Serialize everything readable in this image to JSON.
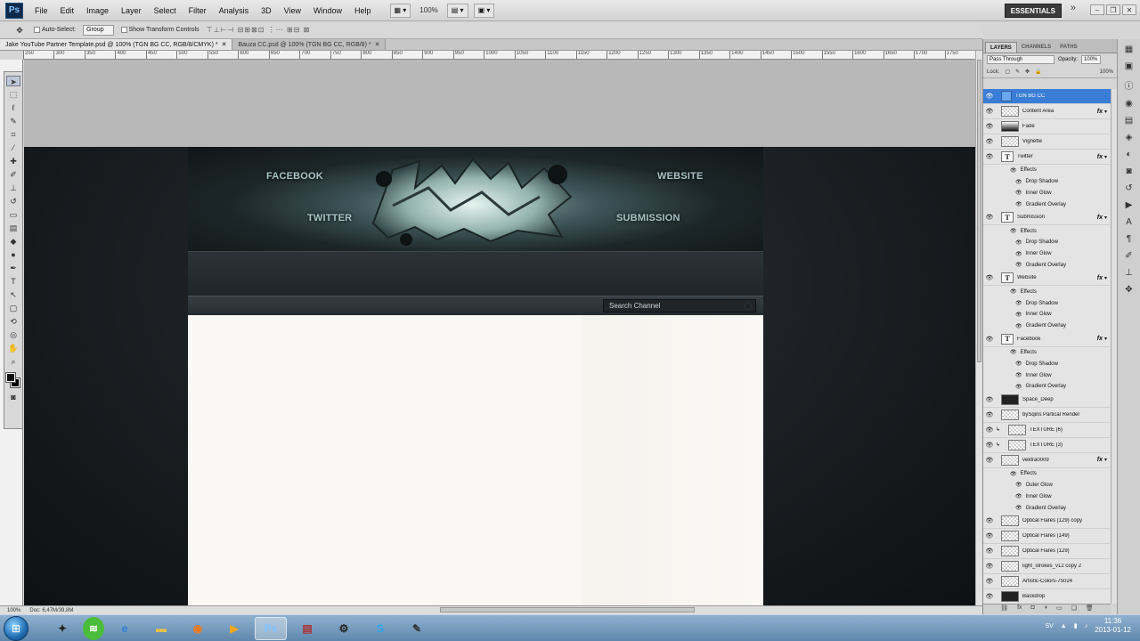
{
  "app": {
    "logo": "Ps",
    "menu": [
      "File",
      "Edit",
      "Image",
      "Layer",
      "Select",
      "Filter",
      "Analysis",
      "3D",
      "View",
      "Window",
      "Help"
    ],
    "zoom": "100%",
    "workspace": "ESSENTIALS"
  },
  "options_bar": {
    "auto_select_label": "Auto-Select:",
    "auto_select_value": "Group",
    "transform_label": "Show Transform Controls"
  },
  "tabs": [
    {
      "label": "Jake YouTube Partner Template.psd @ 100% (TGN BG CC, RGB/8/CMYK) *",
      "active": true
    },
    {
      "label": "Bauza CC.psd @ 100% (TGN BG CC, RGB/8) *",
      "active": false
    }
  ],
  "ruler_ticks": [
    "250",
    "300",
    "350",
    "400",
    "450",
    "500",
    "550",
    "600",
    "650",
    "700",
    "750",
    "800",
    "850",
    "900",
    "950",
    "1000",
    "1050",
    "1100",
    "1150",
    "1200",
    "1250",
    "1300",
    "1350",
    "1400",
    "1450",
    "1500",
    "1550",
    "1600",
    "1650",
    "1700",
    "1750"
  ],
  "canvas": {
    "nav": {
      "facebook": "FACEBOOK",
      "website": "WEBSITE",
      "twitter": "TWITTER",
      "submission": "SUBMISSION"
    },
    "search_placeholder": "Search Channel"
  },
  "status": {
    "zoom": "100%",
    "doc": "Doc: 6,47M/39,8M"
  },
  "layers_panel": {
    "tabs": [
      "LAYERS",
      "CHANNELS",
      "PATHS"
    ],
    "blend_mode": "Pass Through",
    "opacity_label": "Opacity:",
    "opacity": "100%",
    "lock_label": "Lock:",
    "fill": "100%",
    "rows": [
      {
        "kind": "layer",
        "name": "TGN BG CC",
        "thumb": "folder",
        "selected": true,
        "fx": false
      },
      {
        "kind": "layer",
        "name": "Content Area",
        "thumb": "check",
        "fx": true
      },
      {
        "kind": "layer",
        "name": "Fade",
        "thumb": "fade",
        "fx": false
      },
      {
        "kind": "layer",
        "name": "Vignette",
        "thumb": "check",
        "fx": false
      },
      {
        "kind": "layer",
        "name": "Twitter",
        "thumb": "type",
        "fx": true
      },
      {
        "kind": "effects",
        "name": "Effects"
      },
      {
        "kind": "effect",
        "name": "Drop Shadow"
      },
      {
        "kind": "effect",
        "name": "Inner Glow"
      },
      {
        "kind": "effect",
        "name": "Gradient Overlay"
      },
      {
        "kind": "layer",
        "name": "Submission",
        "thumb": "type",
        "fx": true
      },
      {
        "kind": "effects",
        "name": "Effects"
      },
      {
        "kind": "effect",
        "name": "Drop Shadow"
      },
      {
        "kind": "effect",
        "name": "Inner Glow"
      },
      {
        "kind": "effect",
        "name": "Gradient Overlay"
      },
      {
        "kind": "layer",
        "name": "Website",
        "thumb": "type",
        "fx": true
      },
      {
        "kind": "effects",
        "name": "Effects"
      },
      {
        "kind": "effect",
        "name": "Drop Shadow"
      },
      {
        "kind": "effect",
        "name": "Inner Glow"
      },
      {
        "kind": "effect",
        "name": "Gradient Overlay"
      },
      {
        "kind": "layer",
        "name": "Facebook",
        "thumb": "type",
        "fx": true
      },
      {
        "kind": "effects",
        "name": "Effects"
      },
      {
        "kind": "effect",
        "name": "Drop Shadow"
      },
      {
        "kind": "effect",
        "name": "Inner Glow"
      },
      {
        "kind": "effect",
        "name": "Gradient Overlay"
      },
      {
        "kind": "layer",
        "name": "Space_Deep",
        "thumb": "dark",
        "fx": false
      },
      {
        "kind": "layer",
        "name": "bySqins Partical Render",
        "thumb": "check",
        "fx": false
      },
      {
        "kind": "layer",
        "name": "TEXTURE (6)",
        "thumb": "check",
        "fx": false,
        "indent": true
      },
      {
        "kind": "layer",
        "name": "TEXTURE (3)",
        "thumb": "check",
        "fx": false,
        "indent": true
      },
      {
        "kind": "layer",
        "name": "vektra0009",
        "thumb": "check",
        "fx": true
      },
      {
        "kind": "effects",
        "name": "Effects"
      },
      {
        "kind": "effect",
        "name": "Outer Glow"
      },
      {
        "kind": "effect",
        "name": "Inner Glow"
      },
      {
        "kind": "effect",
        "name": "Gradient Overlay"
      },
      {
        "kind": "layer",
        "name": "Optical Flares (129) copy",
        "thumb": "check",
        "fx": false
      },
      {
        "kind": "layer",
        "name": "Optical Flares (149)",
        "thumb": "check",
        "fx": false
      },
      {
        "kind": "layer",
        "name": "Optical Flares (129)",
        "thumb": "check",
        "fx": false
      },
      {
        "kind": "layer",
        "name": "light_strokes_v12 copy 2",
        "thumb": "check",
        "fx": false
      },
      {
        "kind": "layer",
        "name": "Artistic-Colors-75024",
        "thumb": "check",
        "fx": false
      },
      {
        "kind": "layer",
        "name": "Backdrop",
        "thumb": "dark",
        "fx": false
      }
    ]
  },
  "taskbar": {
    "language": "SV",
    "time": "11:36",
    "date": "2013-01-12"
  }
}
